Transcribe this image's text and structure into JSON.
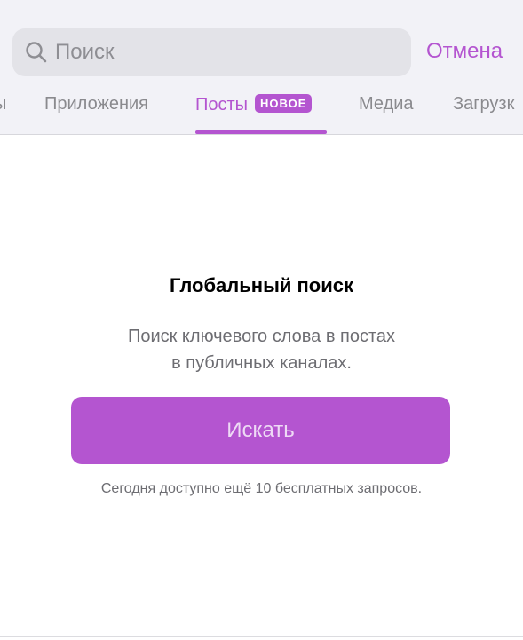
{
  "search": {
    "placeholder": "Поиск",
    "cancel_label": "Отмена"
  },
  "tabs": [
    {
      "label": "ы",
      "active": false
    },
    {
      "label": "Приложения",
      "active": false
    },
    {
      "label": "Посты",
      "active": true,
      "badge": "НОВОЕ"
    },
    {
      "label": "Медиа",
      "active": false
    },
    {
      "label": "Загрузк",
      "active": false
    }
  ],
  "main": {
    "title": "Глобальный поиск",
    "description_line1": "Поиск ключевого слова в постах",
    "description_line2": "в публичных каналах.",
    "button_label": "Искать",
    "footnote": "Сегодня доступно ещё 10 бесплатных запросов."
  },
  "colors": {
    "accent": "#b455d0",
    "background_top": "#f2f2f7",
    "search_field": "#e3e3e8",
    "muted_text": "#8a8a8e"
  },
  "icons": {
    "search": "magnifier-icon"
  }
}
